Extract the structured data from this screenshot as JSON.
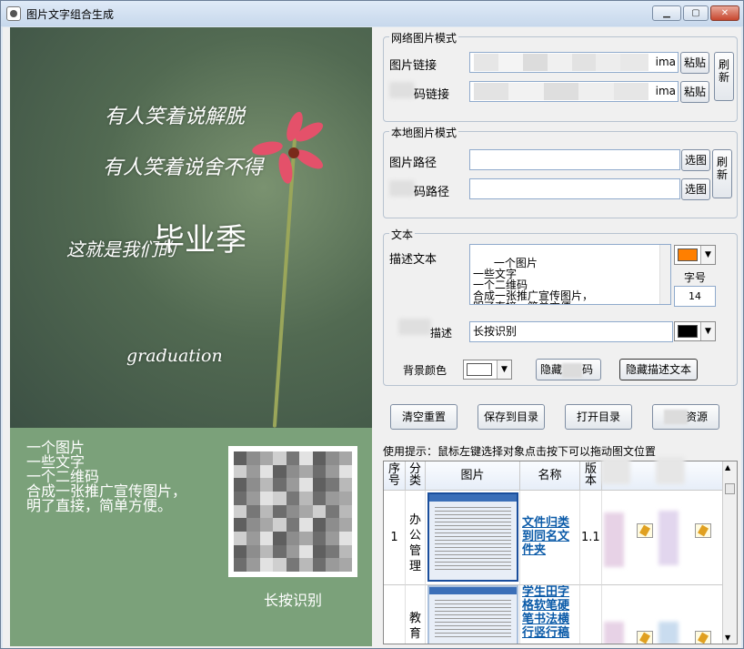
{
  "window": {
    "title": "图片文字组合生成",
    "min_glyph": "▁",
    "max_glyph": "▢",
    "close_glyph": "✕"
  },
  "preview": {
    "lines": [
      "有人笑着说解脱",
      "有人笑着说舍不得",
      "这就是我们的",
      "毕业季",
      "graduation"
    ]
  },
  "card": {
    "description": "一个图片\n一些文字\n一个二维码\n合成一张推广宣传图片，\n明了直接，简单方便。",
    "qr_label": "长按识别"
  },
  "network_group": {
    "title": "网络图片模式",
    "image_url_label": "图片链接",
    "image_url_value": "ima",
    "qr_url_label": "码链接",
    "qr_url_value": "ima",
    "paste_label": "粘贴",
    "refresh_label": "刷新"
  },
  "local_group": {
    "title": "本地图片模式",
    "image_path_label": "图片路径",
    "qr_path_label": "码路径",
    "choose_label": "选图",
    "refresh_label": "刷新"
  },
  "text_group": {
    "title": "文本",
    "desc_label": "描述文本",
    "desc_value": "一个图片\n一些文字\n一个二维码\n合成一张推广宣传图片，\n明了直接，简单方便",
    "font_size_label": "字号",
    "font_size_value": "14",
    "qr_desc_label": "描述",
    "qr_desc_value": "长按识别",
    "bg_color_label": "背景颜色",
    "hide_qr_label": "隐藏",
    "hide_qr_suffix": "码",
    "hide_desc_label": "隐藏描述文本",
    "text_color": "#ff7f00",
    "qr_text_color": "#000000",
    "bg_color": "#ffffff"
  },
  "actions": {
    "reset": "清空重置",
    "save": "保存到目录",
    "open": "打开目录",
    "resource": "资源"
  },
  "hint": "使用提示：鼠标左键选择对象点击按下可以拖动图文位置",
  "table": {
    "headers": [
      "序号",
      "分类",
      "图片",
      "名称",
      "版本"
    ],
    "rows": [
      {
        "no": "1",
        "category": "办公管理",
        "name": "文件归类到同名文件夹",
        "version": "1.1"
      },
      {
        "no": "",
        "category": "教育",
        "name": "学生田字格软笔硬笔书法横行竖行稿",
        "version": ""
      }
    ]
  }
}
